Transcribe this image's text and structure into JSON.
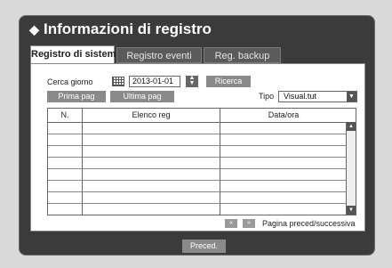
{
  "window": {
    "title": "Informazioni di registro"
  },
  "tabs": [
    {
      "label": "Registro di sistema",
      "active": true
    },
    {
      "label": "Registro eventi",
      "active": false
    },
    {
      "label": "Reg. backup",
      "active": false
    }
  ],
  "search": {
    "label": "Cerca giorno",
    "date_value": "2013-01-01",
    "search_button": "Ricerca"
  },
  "nav": {
    "first_page": "Prima pag",
    "last_page": "Ultima pag"
  },
  "type_filter": {
    "label": "Tipo",
    "selected": "Visual.tut"
  },
  "table": {
    "columns": [
      "N.",
      "Elenco reg",
      "Data/ora"
    ],
    "rows": [
      [
        "",
        "",
        ""
      ],
      [
        "",
        "",
        ""
      ],
      [
        "",
        "",
        ""
      ],
      [
        "",
        "",
        ""
      ],
      [
        "",
        "",
        ""
      ],
      [
        "",
        "",
        ""
      ],
      [
        "",
        "",
        ""
      ]
    ]
  },
  "pagination": {
    "prev_icon": "«",
    "next_icon": "»",
    "label": "Pagina preced/successiva"
  },
  "footer": {
    "back_button": "Preced."
  },
  "icons": [
    "diamond-icon",
    "calendar-icon",
    "spin-up-icon",
    "spin-down-icon",
    "dropdown-arrow-icon",
    "scroll-up-icon",
    "scroll-down-icon"
  ],
  "colors": {
    "window_bg": "#3b3b3b",
    "page_bg": "#d9d9d9",
    "button_bg": "#8a8a8a"
  }
}
